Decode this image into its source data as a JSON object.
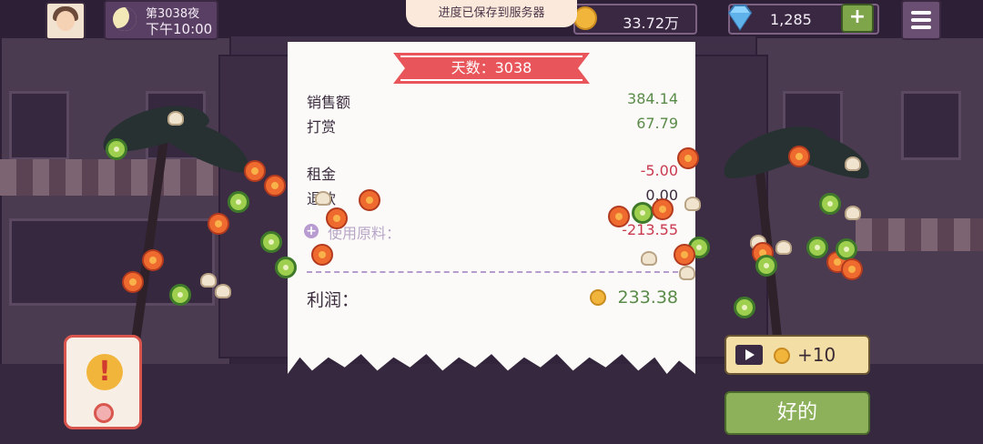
{
  "hud": {
    "day_label": "第3038夜",
    "time_label": "下午10:00",
    "toast": "进度已保存到服务器",
    "coins": "33.72万",
    "gems": "1,285",
    "plus": "+"
  },
  "receipt": {
    "ribbon": "天数：3038",
    "rows": [
      {
        "label": "销售额",
        "value": "384.14"
      },
      {
        "label": "打赏",
        "value": "67.79"
      },
      {
        "label": "租金",
        "value": "-5.00"
      },
      {
        "label": "退款",
        "value": "0.00"
      },
      {
        "label": "使用原料：",
        "value": "-213.55"
      }
    ],
    "profit_label": "利润：",
    "profit_value": "233.38"
  },
  "buttons": {
    "ad_reward": "+10",
    "ok": "好的",
    "alert": "!"
  },
  "icons": [
    "avatar",
    "moon-icon",
    "coin-icon",
    "gem-icon",
    "menu-icon",
    "video-icon",
    "alert-icon"
  ],
  "colors": {
    "positive": "#5a8b48",
    "negative": "#c93a4f",
    "ribbon": "#e8565b",
    "ok_button": "#8cb15a"
  }
}
